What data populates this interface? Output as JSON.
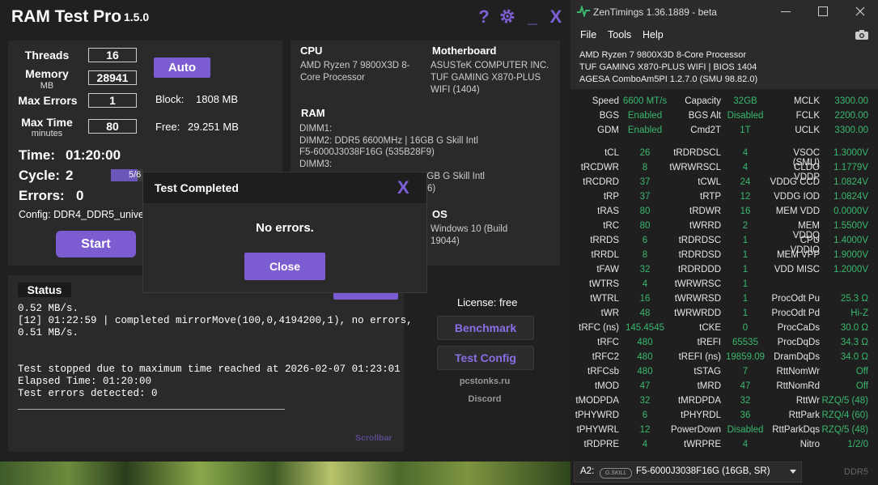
{
  "ramtest": {
    "title": "RAM Test Pro",
    "version": "1.5.0",
    "controls": {
      "help": "?",
      "minimize": "_",
      "close": "X"
    },
    "settings": {
      "threads_label": "Threads",
      "threads_value": "16",
      "memory_label": "Memory",
      "memory_unit": "MB",
      "memory_value": "28941",
      "max_errors_label": "Max Errors",
      "max_errors_value": "1",
      "max_time_label": "Max Time",
      "max_time_unit": "minutes",
      "max_time_value": "80",
      "auto_button": "Auto",
      "block_label": "Block:",
      "block_value": "1808 MB",
      "free_label": "Free:",
      "free_value": "29.251 MB"
    },
    "progress": {
      "time_label": "Time:",
      "time_value": "01:20:00",
      "cycle_label": "Cycle:",
      "cycle_value": "2",
      "cycle_bar_text": "5/6",
      "cycle_fraction": 0.83,
      "errors_label": "Errors:",
      "errors_value": "0",
      "config_label": "Config: DDR4_DDR5_unive",
      "start_button": "Start"
    },
    "sysinfo": {
      "cpu_head": "CPU",
      "cpu_line1": "AMD Ryzen 7 9800X3D 8-",
      "cpu_line2": "Core Processor",
      "mb_head": "Motherboard",
      "mb_line1": "ASUSTeK COMPUTER INC.",
      "mb_line2": "TUF GAMING X870-PLUS",
      "mb_line3": "WIFI (1404)",
      "ram_head": "RAM",
      "ram_line1": "DIMM1:",
      "ram_line2": "DIMM2: DDR5 6600MHz | 16GB G Skill Intl",
      "ram_line3": "F5-6000J3038F16G (535B28F9)",
      "ram_line4": "DIMM3:",
      "ram_line5": "6GB G Skill Intl",
      "ram_line6": "F6)",
      "os_head": "OS",
      "os_line1": "Windows 10 (Build",
      "os_line2": "19044)"
    },
    "status": {
      "title": "Status",
      "open_log": "Open Log",
      "lines": [
        "0.52 MB/s.",
        "[12] 01:22:59 | completed mirrorMove(100,0,4194200,1), no errors,",
        "0.51 MB/s.",
        "",
        "",
        "Test stopped due to maximum time reached at 2026-02-07 01:23:01",
        "Elapsed Time: 01:20:00",
        "Test errors detected: 0",
        "____________________________________________"
      ],
      "scrollbar": "Scrollbar"
    },
    "side": {
      "license": "License: free",
      "benchmark": "Benchmark",
      "test_config": "Test Config",
      "site": "pcstonks.ru",
      "discord": "Discord"
    },
    "dialog": {
      "title": "Test Completed",
      "close_x": "X",
      "message": "No errors.",
      "close_button": "Close"
    }
  },
  "zentimings": {
    "title": "ZenTimings 1.36.1889 - beta",
    "menu": [
      "File",
      "Tools",
      "Help"
    ],
    "info1": "AMD Ryzen 7 9800X3D 8-Core Processor",
    "info2": "TUF GAMING X870-PLUS WIFI | BIOS 1404",
    "info3": "AGESA ComboAm5PI 1.2.7.0 (SMU 98.82.0)",
    "header_rows": [
      [
        "Speed",
        "6600 MT/s",
        "Capacity",
        "32GB",
        "MCLK",
        "3300.00"
      ],
      [
        "BGS",
        "Enabled",
        "BGS Alt",
        "Disabled",
        "FCLK",
        "2200.00"
      ],
      [
        "GDM",
        "Enabled",
        "Cmd2T",
        "1T",
        "UCLK",
        "3300.00"
      ]
    ],
    "timing_rows": [
      [
        "tCL",
        "26",
        "tRDRDSCL",
        "4",
        "VSOC (SMU)",
        "1.3000V"
      ],
      [
        "tRCDWR",
        "8",
        "tWRWRSCL",
        "4",
        "CLDO VDDP",
        "1.1779V"
      ],
      [
        "tRCDRD",
        "37",
        "tCWL",
        "24",
        "VDDG CCD",
        "1.0824V"
      ],
      [
        "tRP",
        "37",
        "tRTP",
        "12",
        "VDDG IOD",
        "1.0824V"
      ],
      [
        "tRAS",
        "80",
        "tRDWR",
        "16",
        "MEM VDD",
        "0.0000V"
      ],
      [
        "tRC",
        "80",
        "tWRRD",
        "2",
        "MEM VDDQ",
        "1.5500V"
      ],
      [
        "tRRDS",
        "6",
        "tRDRDSC",
        "1",
        "CPU VDDIO",
        "1.4000V"
      ],
      [
        "tRRDL",
        "8",
        "tRDRDSD",
        "1",
        "MEM VPP",
        "1.9000V"
      ],
      [
        "tFAW",
        "32",
        "tRDRDDD",
        "1",
        "VDD MISC",
        "1.2000V"
      ],
      [
        "tWTRS",
        "4",
        "tWRWRSC",
        "1",
        "",
        ""
      ],
      [
        "tWTRL",
        "16",
        "tWRWRSD",
        "1",
        "ProcOdt Pu",
        "25.3 Ω"
      ],
      [
        "tWR",
        "48",
        "tWRWRDD",
        "1",
        "ProcOdt Pd",
        "Hi-Z"
      ],
      [
        "tRFC (ns)",
        "145.4545",
        "tCKE",
        "0",
        "ProcCaDs",
        "30.0 Ω"
      ],
      [
        "tRFC",
        "480",
        "tREFI",
        "65535",
        "ProcDqDs",
        "34.3 Ω"
      ],
      [
        "tRFC2",
        "480",
        "tREFI (ns)",
        "19859.09",
        "DramDqDs",
        "34.0 Ω"
      ],
      [
        "tRFCsb",
        "480",
        "tSTAG",
        "7",
        "RttNomWr",
        "Off"
      ],
      [
        "tMOD",
        "47",
        "tMRD",
        "47",
        "RttNomRd",
        "Off"
      ],
      [
        "tMODPDA",
        "32",
        "tMRDPDA",
        "32",
        "RttWr",
        "RZQ/5 (48)"
      ],
      [
        "tPHYWRD",
        "6",
        "tPHYRDL",
        "36",
        "RttPark",
        "RZQ/4 (60)"
      ],
      [
        "tPHYWRL",
        "12",
        "PowerDown",
        "Disabled",
        "RttParkDqs",
        "RZQ/5 (48)"
      ],
      [
        "tRDPRE",
        "4",
        "tWRPRE",
        "4",
        "Nitro",
        "1/2/0"
      ]
    ],
    "slot_label": "A2:",
    "brand": "G.SKILL",
    "module": "F5-6000J3038F16G (16GB, SR)",
    "mem_type": "DDR5"
  },
  "colors": {
    "accent": "#7c5cd1",
    "zen_green": "#39b86d"
  }
}
